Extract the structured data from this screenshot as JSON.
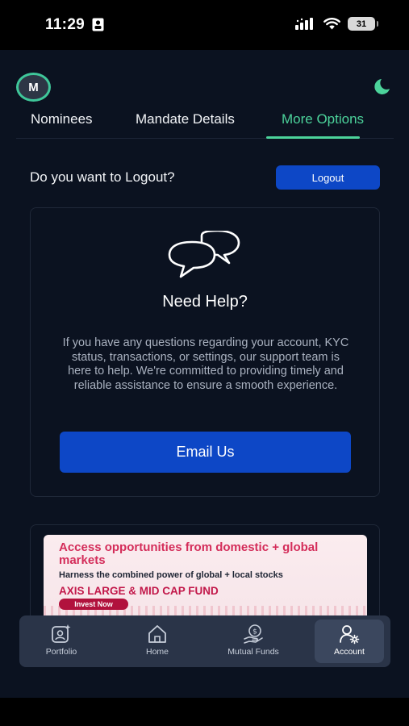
{
  "status_bar": {
    "time": "11:29",
    "battery": "31"
  },
  "header": {
    "avatar_initial": "M"
  },
  "tabs": [
    {
      "label": "Nominees",
      "active": false
    },
    {
      "label": "Mandate Details",
      "active": false
    },
    {
      "label": "More Options",
      "active": true
    }
  ],
  "logout": {
    "question": "Do you want to Logout?",
    "button_label": "Logout"
  },
  "help": {
    "title": "Need Help?",
    "text": "If you have any questions regarding your account, KYC status, transactions, or settings, our support team is here to help. We're committed to providing timely and reliable assistance to ensure a smooth experience.",
    "button_label": "Email Us"
  },
  "promo": {
    "headline": "Access opportunities from domestic + global markets",
    "subline": "Harness the combined power of global + local stocks",
    "fund_name": "AXIS LARGE & MID CAP FUND",
    "cta": "Invest Now"
  },
  "bottom_nav": [
    {
      "label": "Portfolio",
      "icon": "portfolio-icon",
      "active": false
    },
    {
      "label": "Home",
      "icon": "home-icon",
      "active": false
    },
    {
      "label": "Mutual Funds",
      "icon": "mutual-funds-icon",
      "active": false
    },
    {
      "label": "Account",
      "icon": "account-settings-icon",
      "active": true
    }
  ],
  "colors": {
    "background": "#0b1220",
    "accent_green": "#4cd39b",
    "primary_blue": "#0d47c6",
    "nav_bg": "#2a3448"
  }
}
